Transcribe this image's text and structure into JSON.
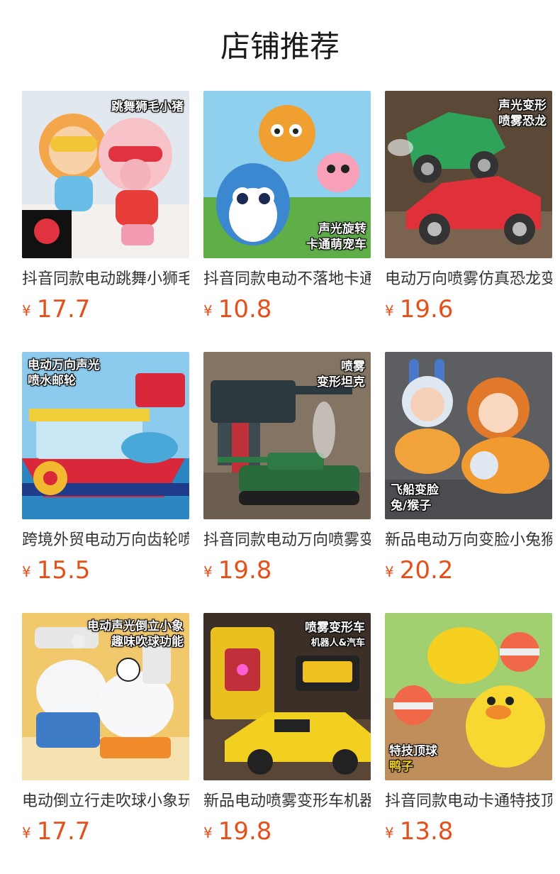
{
  "page": {
    "title": "店铺推荐",
    "accent_color": "#e5501a"
  },
  "products": [
    {
      "name": "抖音同款电动跳舞小狮毛小猪",
      "currency": "¥",
      "price": "17.7",
      "caption": [
        "跳舞狮毛小猪"
      ],
      "bg": "#dfe6ee",
      "icon": "dancing-pig-toy-icon"
    },
    {
      "name": "抖音同款电动不落地卡通萌宠车",
      "currency": "¥",
      "price": "10.8",
      "caption": [
        "声光旋转",
        "卡通萌宠车"
      ],
      "bg": "#6fbf5a",
      "icon": "cartoon-pet-car-toy-icon"
    },
    {
      "name": "电动万向喷雾仿真恐龙变形车",
      "currency": "¥",
      "price": "19.6",
      "caption": [
        "声光变形",
        "喷雾恐龙"
      ],
      "bg": "#5a4632",
      "icon": "dinosaur-car-toy-icon"
    },
    {
      "name": "跨境外贸电动万向齿轮喷水邮轮",
      "currency": "¥",
      "price": "15.5",
      "caption": [
        "电动万向声光",
        "喷水邮轮"
      ],
      "bg": "#7ec0e8",
      "icon": "cruise-ship-toy-icon"
    },
    {
      "name": "抖音同款电动万向喷雾变形坦克",
      "currency": "¥",
      "price": "19.8",
      "caption": [
        "喷雾",
        "变形坦克"
      ],
      "bg": "#8a7a68",
      "icon": "transforming-tank-toy-icon"
    },
    {
      "name": "新品电动万向变脸小兔猴子飞船",
      "currency": "¥",
      "price": "20.2",
      "caption": [
        "飞船变脸",
        "兔/猴子"
      ],
      "bg": "#5d5f63",
      "icon": "face-changing-rabbit-monkey-toy-icon"
    },
    {
      "name": "电动倒立行走吹球小象玩具",
      "currency": "¥",
      "price": "17.7",
      "caption": [
        "电动声光倒立小象",
        "趣味吹球功能"
      ],
      "bg": "#f1c66a",
      "icon": "elephant-toy-icon"
    },
    {
      "name": "新品电动喷雾变形车机器人汽车",
      "currency": "¥",
      "price": "19.8",
      "caption": [
        "喷雾变形车",
        "机器人&汽车"
      ],
      "bg": "#3a2f2a",
      "icon": "transformer-car-toy-icon"
    },
    {
      "name": "抖音同款电动卡通特技顶球鸭子",
      "currency": "¥",
      "price": "13.8",
      "caption": [
        "特技顶球",
        "鸭子"
      ],
      "bg": "#9ecf6e",
      "icon": "duck-toy-icon"
    }
  ]
}
